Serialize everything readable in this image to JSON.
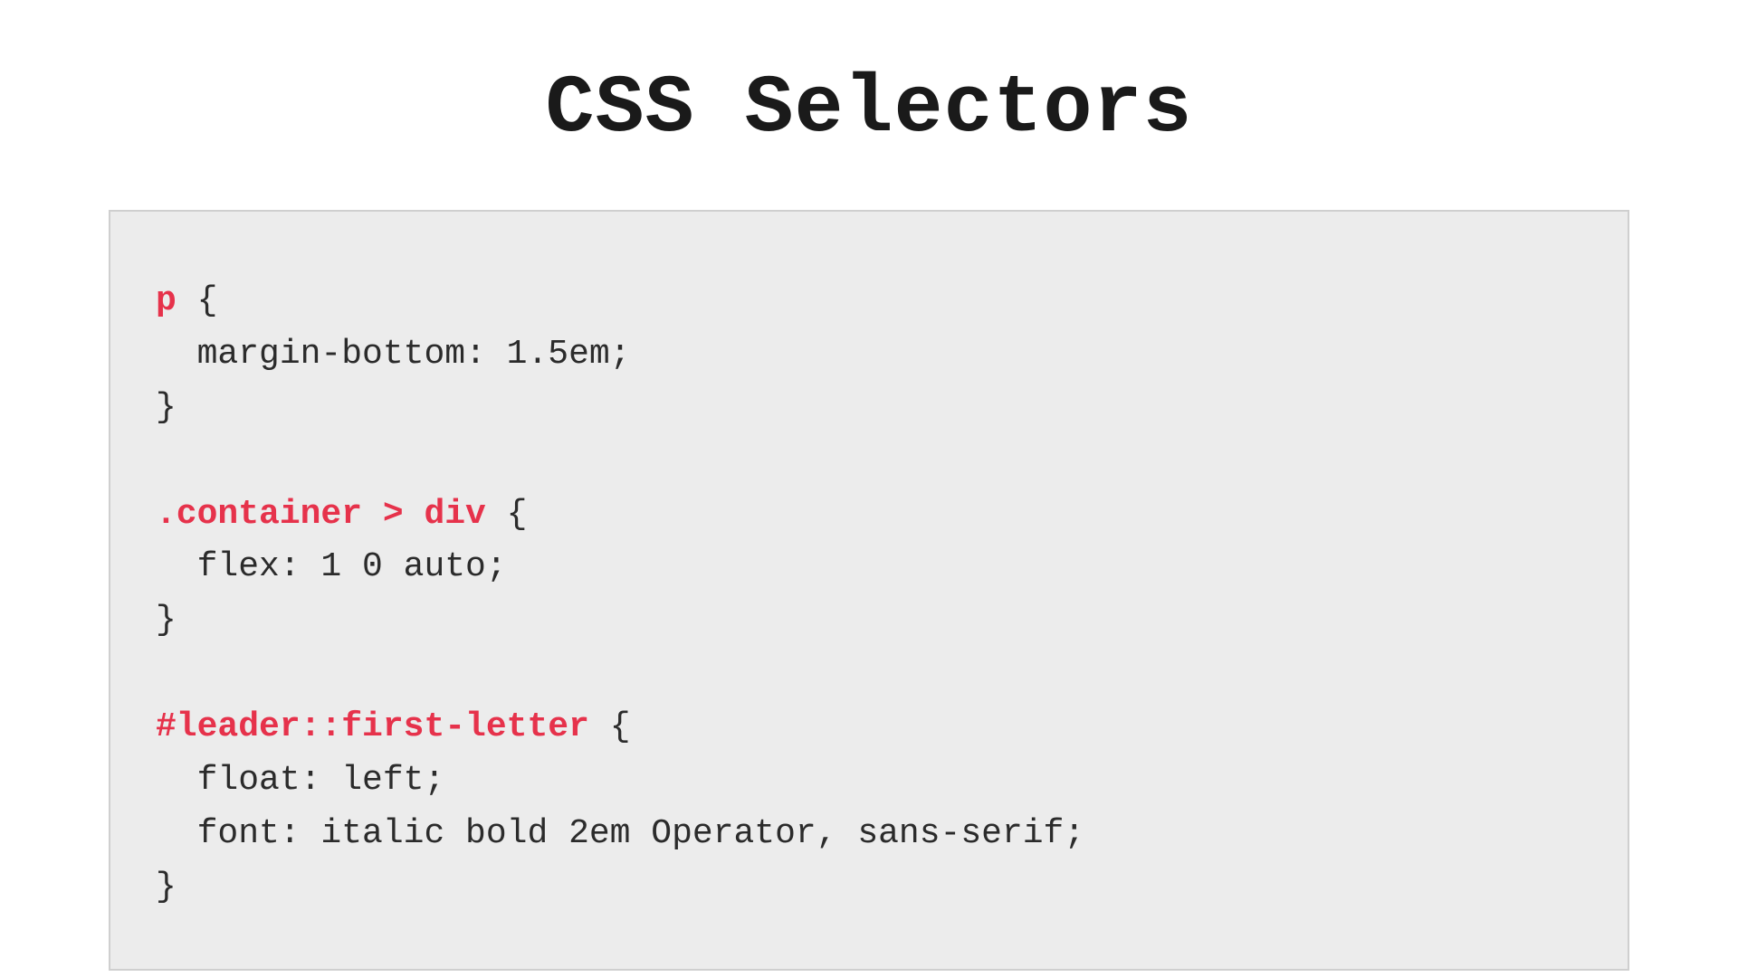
{
  "title": "CSS Selectors",
  "colors": {
    "selector": "#e6324b",
    "code_bg": "#ececec",
    "code_border": "#cfcfcf",
    "text": "#2b2b2b"
  },
  "code": {
    "rules": [
      {
        "selector": "p",
        "open": " {",
        "declarations": [
          "  margin-bottom: 1.5em;"
        ],
        "close": "}"
      },
      {
        "selector": ".container > div",
        "open": " {",
        "declarations": [
          "  flex: 1 0 auto;"
        ],
        "close": "}"
      },
      {
        "selector": "#leader::first-letter",
        "open": " {",
        "declarations": [
          "  float: left;",
          "  font: italic bold 2em Operator, sans-serif;"
        ],
        "close": "}"
      }
    ]
  }
}
